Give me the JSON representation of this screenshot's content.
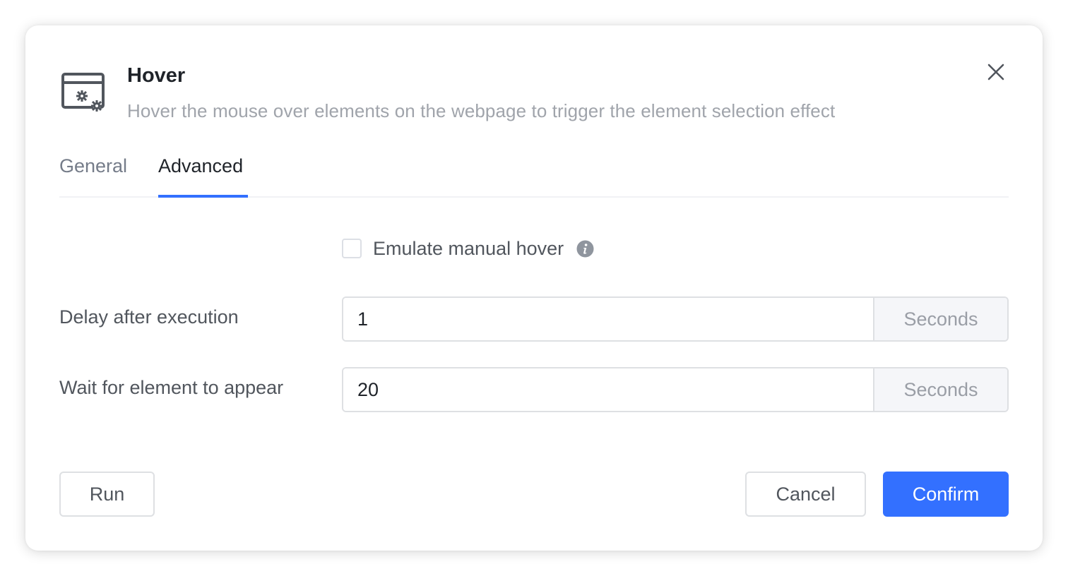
{
  "dialog": {
    "title": "Hover",
    "subtitle": "Hover the mouse over elements on the webpage to trigger the element selection effect",
    "header_icon": "window-settings-icon",
    "close_icon": "close-icon"
  },
  "tabs": [
    {
      "label": "General",
      "active": false
    },
    {
      "label": "Advanced",
      "active": true
    }
  ],
  "advanced": {
    "emulate_hover": {
      "label": "Emulate manual hover",
      "checked": false,
      "info_icon": "info-icon"
    },
    "delay": {
      "label": "Delay after execution",
      "value": "1",
      "unit": "Seconds"
    },
    "wait": {
      "label": "Wait for element to appear",
      "value": "20",
      "unit": "Seconds"
    }
  },
  "footer": {
    "run_label": "Run",
    "cancel_label": "Cancel",
    "confirm_label": "Confirm"
  },
  "colors": {
    "accent": "#3370ff",
    "title": "#1f2329",
    "subtitle": "#a0a4ab"
  }
}
